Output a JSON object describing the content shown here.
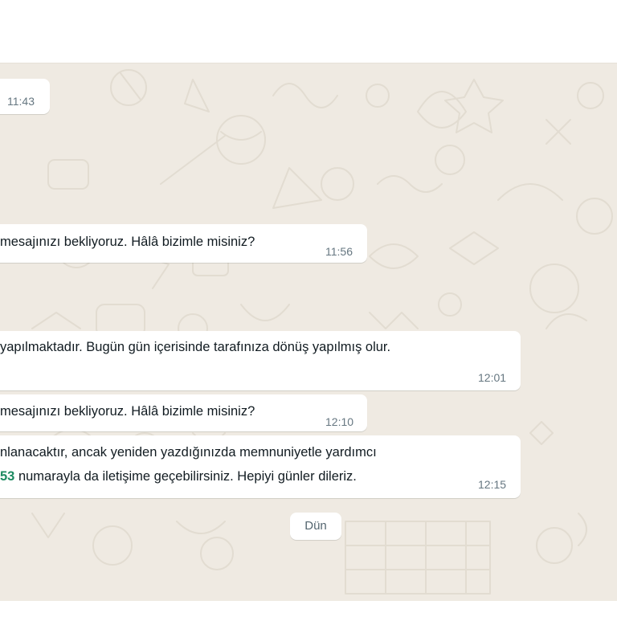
{
  "messages": [
    {
      "time": "11:43"
    },
    {
      "text": "mesajınızı bekliyoruz. Hâlâ bizimle misiniz?",
      "time": "11:56"
    },
    {
      "text": "yapılmaktadır. Bugün gün içerisinde tarafınıza dönüş yapılmış olur.",
      "time": "12:01"
    },
    {
      "text": "mesajınızı bekliyoruz. Hâlâ bizimle misiniz?",
      "time": "12:10"
    },
    {
      "line1": "nlanacaktır, ancak yeniden yazdığınızda memnuniyetle yardımcı",
      "highlight": "53",
      "line2": " numarayla da iletişime geçebilirsiniz. Hepiyi günler dileriz.",
      "time": "12:15"
    }
  ],
  "date_separator": "Dün",
  "colors": {
    "chat_background": "#efeae2",
    "bubble": "#ffffff",
    "link_highlight": "#1d8a61",
    "timestamp": "#667781"
  }
}
